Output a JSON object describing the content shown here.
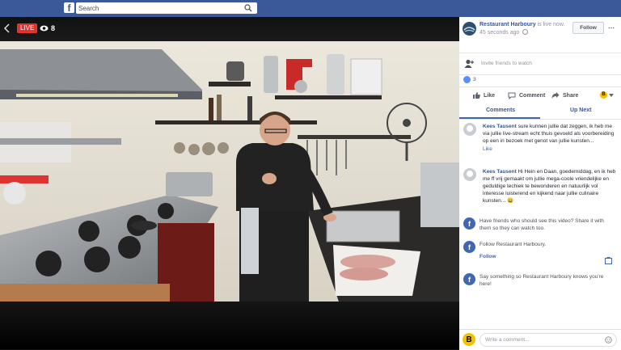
{
  "topbar": {
    "logo": "f",
    "search_placeholder": "Search"
  },
  "video": {
    "live_label": "LIVE",
    "viewer_count": "8"
  },
  "page": {
    "name": "Restaurant Harboury",
    "live_text": " is live now.",
    "time_ago": "45 seconds ago",
    "follow_label": "Follow"
  },
  "invite_text": "Invite friends to watch",
  "reaction_count": "3",
  "actions": {
    "like": "Like",
    "comment": "Comment",
    "share": "Share",
    "page_avatar_letter": "B"
  },
  "tabs": {
    "comments": "Comments",
    "up_next": "Up Next"
  },
  "comments": [
    {
      "author": "Kees Tausent",
      "text": " sure kunnen jullie dat zeggen, ik heb me via jullie live-stream echt thuis gevoeld als voorbereiding op een iri bezoek met genot van jullie kunsten...",
      "like": "Like"
    },
    {
      "author": "Kees Tausent",
      "text": " Hi Hein en Daan, goedemiddag, en ik heb me ff vrij gemaakt om jullie mega-coole vriendelijke en geduldige techiek te bewonderen en natuurlijk vol interesse luisterend en kijkend naar jullie culinaire kunsten... 😀",
      "like": "Like"
    }
  ],
  "notices": {
    "share": "Have friends who should see this video? Share it with them so they can watch too.",
    "follow_text": "Follow Restaurant Harboury.",
    "follow_link": "Follow",
    "say": "Say something so Restaurant Harboury knows you're here!"
  },
  "composer": {
    "avatar_letter": "B",
    "placeholder": "Write a comment..."
  }
}
